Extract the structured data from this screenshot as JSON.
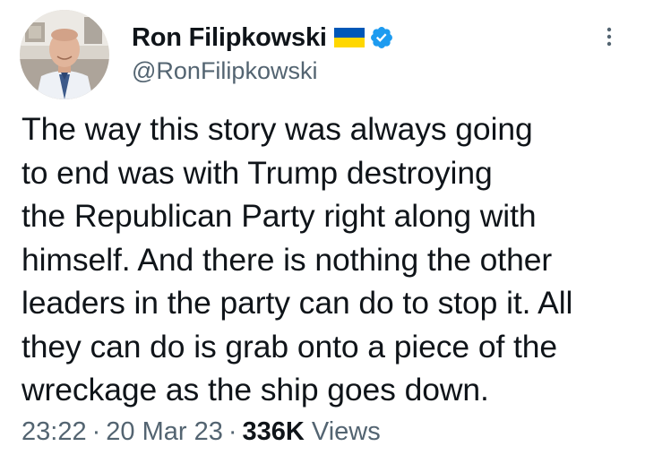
{
  "author": {
    "display_name": "Ron Filipkowski",
    "handle": "@RonFilipkowski",
    "flag_icon": "ukraine-flag-icon",
    "verified_icon": "verified-badge-icon",
    "verified_color": "#1d9bf0"
  },
  "more_icon": "more-vertical-icon",
  "body": {
    "lines": [
      "The way this story was always going",
      "to end was with Trump destroying",
      "the Republican Party right along with",
      "himself. And there is nothing the other",
      "leaders in the party can do to stop it. All",
      "they can do is grab onto a piece of the",
      "wreckage as the ship goes down."
    ]
  },
  "meta": {
    "time": "23:22",
    "date": "20 Mar 23",
    "separator": "·",
    "views_count": "336K",
    "views_label": "Views"
  },
  "colors": {
    "text_primary": "#0f1419",
    "text_secondary": "#536471",
    "flag_blue": "#0057b7",
    "flag_yellow": "#ffd700"
  }
}
